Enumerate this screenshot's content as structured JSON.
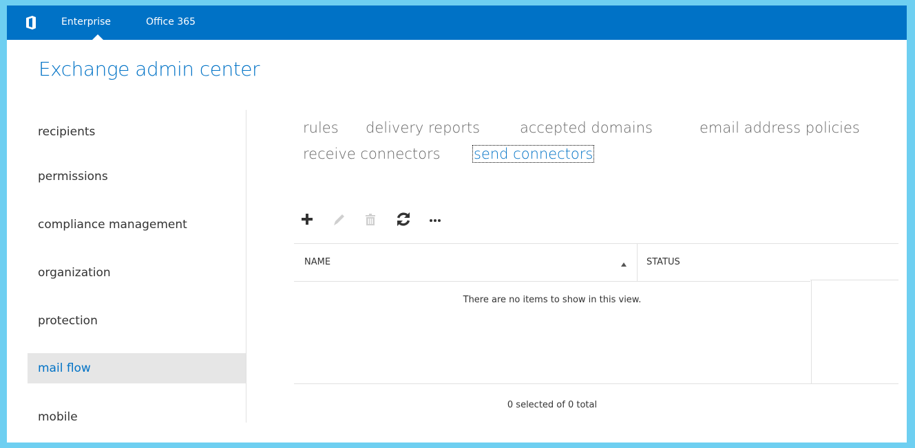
{
  "topbar": {
    "logo_icon": "office-logo-icon",
    "nav": [
      "Enterprise",
      "Office 365"
    ]
  },
  "app_title": "Exchange admin center",
  "leftnav": {
    "items": [
      "recipients",
      "permissions",
      "compliance management",
      "organization",
      "protection",
      "mail flow",
      "mobile"
    ],
    "selected": "mail flow"
  },
  "subtabs": {
    "items": [
      "rules",
      "delivery reports",
      "accepted domains",
      "email address policies",
      "receive connectors",
      "send connectors"
    ],
    "active": "send connectors"
  },
  "toolbar": {
    "icons": [
      "add-icon",
      "edit-icon",
      "delete-icon",
      "refresh-icon",
      "more-icon"
    ]
  },
  "grid": {
    "columns": [
      "NAME",
      "STATUS"
    ],
    "sort": "ascending",
    "empty_message": "There are no items to show in this view."
  },
  "footer": {
    "count_text": "0 selected of 0 total"
  },
  "colors": {
    "accent": "#0072c6",
    "frame": "#6ecff1",
    "selected_bg": "#e6e6e6"
  }
}
